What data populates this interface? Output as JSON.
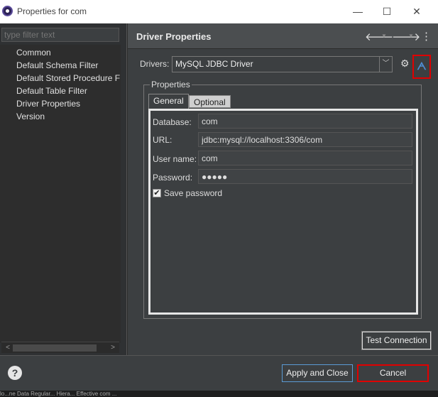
{
  "window": {
    "title": "Properties for com",
    "minimize": "—",
    "maximize": "☐",
    "close": "✕"
  },
  "sidebar": {
    "filter_placeholder": "type filter text",
    "items": [
      {
        "label": "Common"
      },
      {
        "label": "Default Schema Filter"
      },
      {
        "label": "Default Stored Procedure F"
      },
      {
        "label": "Default Table Filter"
      },
      {
        "label": "Driver Properties"
      },
      {
        "label": "Version"
      }
    ]
  },
  "header": {
    "title": "Driver Properties",
    "back": "🡐",
    "forward": "🡒",
    "dropdown": "▼",
    "menu": "⋮"
  },
  "drivers": {
    "label": "Drivers:",
    "selected": "MySQL JDBC Driver",
    "dd_glyph": "﹀",
    "gear_glyph": "⚙",
    "def_glyph": "ᗅ"
  },
  "properties": {
    "legend": "Properties",
    "tabs": [
      {
        "label": "General"
      },
      {
        "label": "Optional"
      }
    ],
    "fields": {
      "database_label": "Database:",
      "database_value": "com",
      "url_label": "URL:",
      "url_value": "jdbc:mysql://localhost:3306/com",
      "username_label": "User name:",
      "username_value": "com",
      "password_label": "Password:",
      "password_value": "●●●●●"
    },
    "save_password_label": "Save password",
    "save_password_checked": "✔"
  },
  "buttons": {
    "test_connection": "Test Connection",
    "apply_close": "Apply and Close",
    "cancel": "Cancel",
    "help": "?"
  },
  "bottom_strip_text": "lo...ne Data   Regular...  Hiera... Effective   com   ..."
}
